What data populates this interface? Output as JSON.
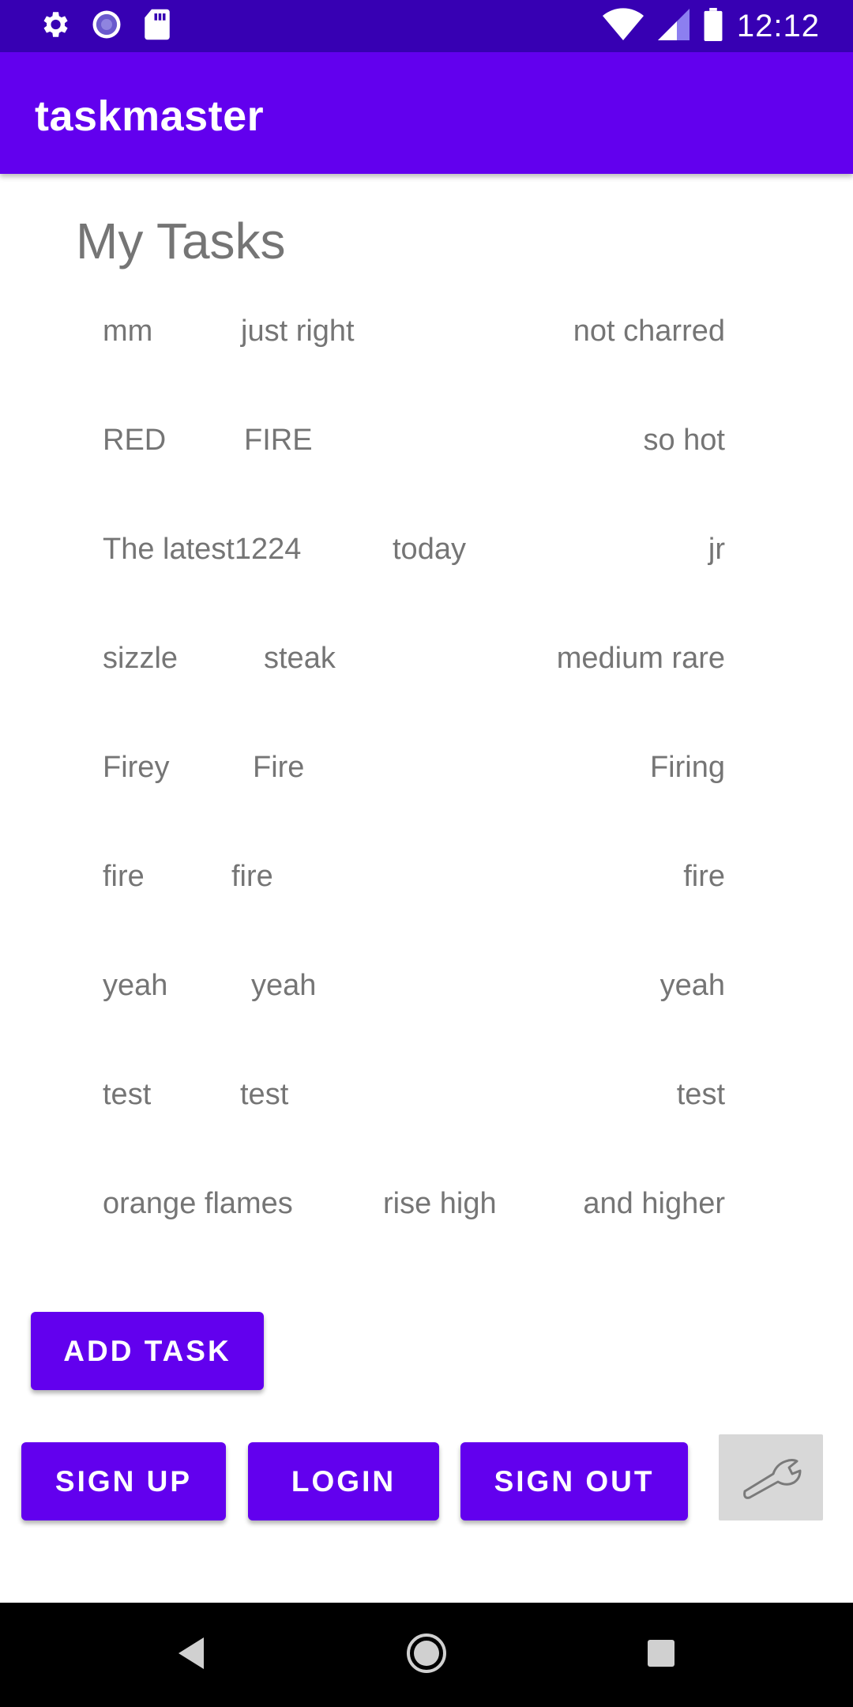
{
  "status_bar": {
    "time": "12:12",
    "left_icons": [
      "gear-icon",
      "sync-icon",
      "sd-card-icon"
    ],
    "right_icons": [
      "wifi-icon",
      "signal-icon",
      "battery-icon"
    ]
  },
  "app_bar": {
    "title": "taskmaster"
  },
  "page": {
    "title": "My Tasks"
  },
  "tasks": [
    {
      "title": "mm",
      "body": "just right",
      "state": "not charred"
    },
    {
      "title": "RED",
      "body": "FIRE",
      "state": "so hot"
    },
    {
      "title": "The latest1224",
      "body": "today",
      "state": "jr"
    },
    {
      "title": "sizzle",
      "body": "steak",
      "state": "medium rare"
    },
    {
      "title": "Firey",
      "body": "Fire",
      "state": "Firing"
    },
    {
      "title": "fire",
      "body": "fire",
      "state": "fire"
    },
    {
      "title": "yeah",
      "body": "yeah",
      "state": "yeah"
    },
    {
      "title": "test",
      "body": "test",
      "state": "test"
    },
    {
      "title": "orange flames",
      "body": "rise high",
      "state": "and higher"
    }
  ],
  "buttons": {
    "add_task": "ADD TASK",
    "sign_up": "SIGN UP",
    "login": "LOGIN",
    "sign_out": "SIGN OUT",
    "settings_icon": "wrench-icon"
  },
  "nav_bar": {
    "buttons": [
      "back-icon",
      "home-icon",
      "recents-icon"
    ]
  },
  "colors": {
    "status_bar": "#3700b3",
    "primary": "#6200ee",
    "task_text": "#757575",
    "settings_button": "#d8d8d8"
  }
}
